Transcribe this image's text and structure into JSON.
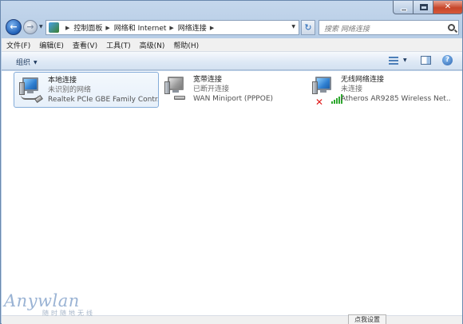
{
  "window": {
    "controls": {
      "minimize": "minimize",
      "maximize": "maximize",
      "close": "✕"
    }
  },
  "nav": {
    "back": "←",
    "forward": "→",
    "breadcrumbs": [
      "控制面板",
      "网络和 Internet",
      "网络连接"
    ],
    "search_placeholder": "搜索 网络连接"
  },
  "menu": {
    "items": [
      "文件(F)",
      "编辑(E)",
      "查看(V)",
      "工具(T)",
      "高级(N)",
      "帮助(H)"
    ]
  },
  "toolbar": {
    "organize_label": "组织",
    "help_label": "?"
  },
  "connections": [
    {
      "name": "本地连接",
      "status": "未识别的网络",
      "device": "Realtek PCIe GBE Family Contr...",
      "icon": "wired-network-icon",
      "selected": true
    },
    {
      "name": "宽带连接",
      "status": "已断开连接",
      "device": "WAN Miniport (PPPOE)",
      "icon": "broadband-icon",
      "selected": false
    },
    {
      "name": "无线网络连接",
      "status": "未连接",
      "device": "Atheros AR9285 Wireless Net...",
      "icon": "wireless-network-icon",
      "selected": false
    }
  ],
  "statusbar": {
    "settings_tab": "点我设置"
  },
  "watermark": {
    "logo": "Anywlan",
    "sub": "随时随地无线"
  },
  "colors": {
    "frame": "#b9cfe8",
    "selection": "#e7f0fa",
    "accent": "#2a63b0",
    "error": "#e01b1b",
    "signal": "#2fa82f"
  }
}
